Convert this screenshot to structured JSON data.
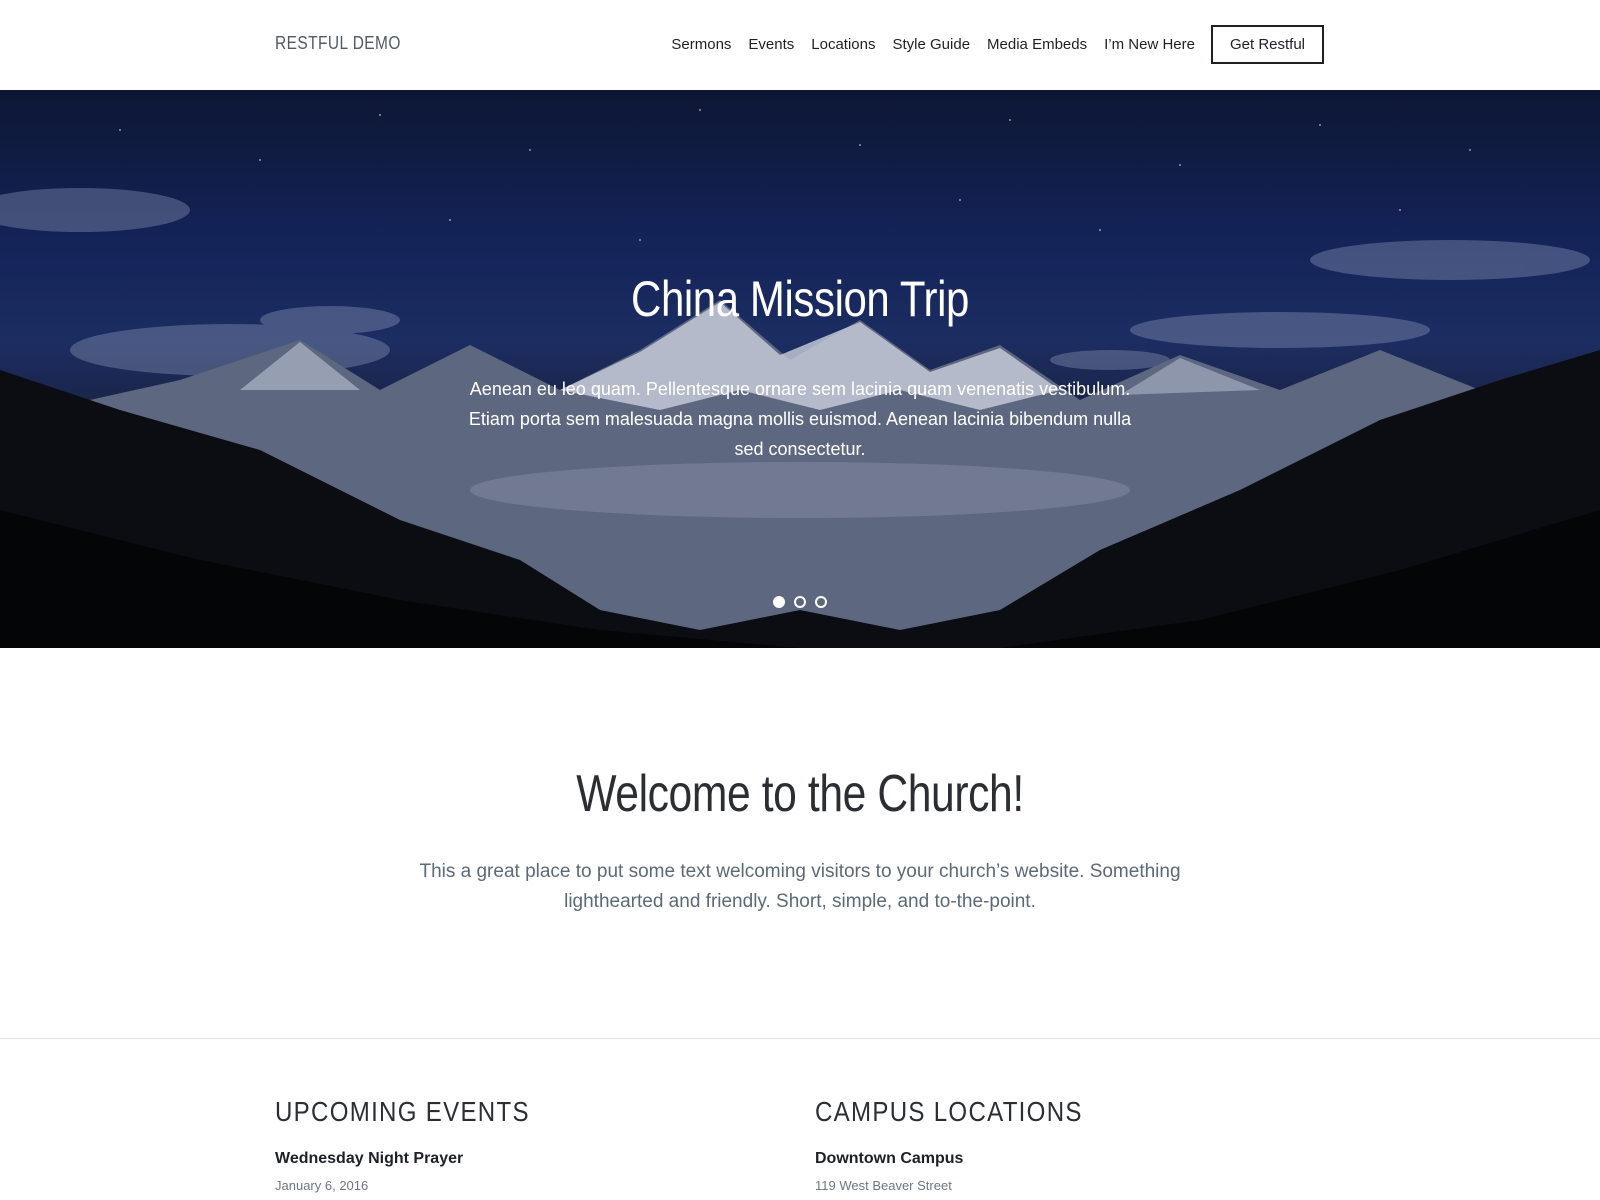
{
  "site": {
    "logo": "RESTFUL DEMO"
  },
  "nav": {
    "items": [
      "Sermons",
      "Events",
      "Locations",
      "Style Guide",
      "Media Embeds",
      "I’m New Here"
    ],
    "cta_label": "Get Restful"
  },
  "hero": {
    "title": "China Mission Trip",
    "text": "Aenean eu leo quam. Pellentesque ornare sem lacinia quam venenatis vestibulum. Etiam porta sem malesuada magna mollis euismod. Aenean lacinia bibendum nulla sed consectetur.",
    "slide_count": 3,
    "active_slide": 1
  },
  "welcome": {
    "title": "Welcome to the Church!",
    "text": "This a great place to put some text welcoming visitors to your church’s website. Something lighthearted and friendly. Short, simple, and to-the-point."
  },
  "events": {
    "heading": "UPCOMING EVENTS",
    "first_title": "Wednesday Night Prayer",
    "first_date": "January 6, 2016"
  },
  "locations": {
    "heading": "CAMPUS LOCATIONS",
    "first_title": "Downtown Campus",
    "first_address": "119 West Beaver Street"
  },
  "colors": {
    "text_dark": "#1d2126",
    "text_muted": "#5a6a78",
    "hero_sky": "#14245a"
  }
}
